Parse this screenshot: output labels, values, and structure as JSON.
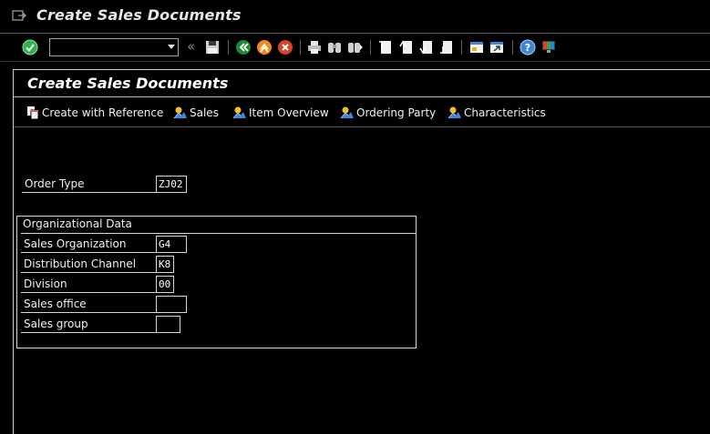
{
  "window": {
    "title": "Create Sales Documents"
  },
  "toolbar": {
    "command_field": {
      "value": "",
      "placeholder": ""
    },
    "icons": [
      "enter-icon",
      "save-icon",
      "back-icon",
      "exit-icon",
      "cancel-icon",
      "print-icon",
      "find-icon",
      "find-next-icon",
      "first-page-icon",
      "previous-page-icon",
      "next-page-icon",
      "last-page-icon",
      "create-session-icon",
      "shortcut-icon",
      "help-icon",
      "customize-layout-icon"
    ]
  },
  "screen": {
    "title": "Create Sales Documents",
    "app_toolbar": {
      "create_with_reference": "Create with Reference",
      "sales": "Sales",
      "item_overview": "Item Overview",
      "ordering_party": "Ordering Party",
      "characteristics": "Characteristics"
    },
    "order_type": {
      "label": "Order Type",
      "value": "ZJ02"
    },
    "org_data": {
      "title": "Organizational Data",
      "fields": [
        {
          "label": "Sales Organization",
          "value": "G4"
        },
        {
          "label": "Distribution Channel",
          "value": "K8"
        },
        {
          "label": "Division",
          "value": "00"
        },
        {
          "label": "Sales office",
          "value": ""
        },
        {
          "label": "Sales group",
          "value": ""
        }
      ]
    }
  },
  "colors": {
    "background": "#000000",
    "text": "#f0f0f0",
    "border": "#d8d8d8",
    "enter_green": "#2db34a",
    "back_green": "#1e8a3a",
    "exit_orange": "#f08a1c",
    "cancel_red": "#d9412b",
    "help_blue": "#3f86d6"
  }
}
